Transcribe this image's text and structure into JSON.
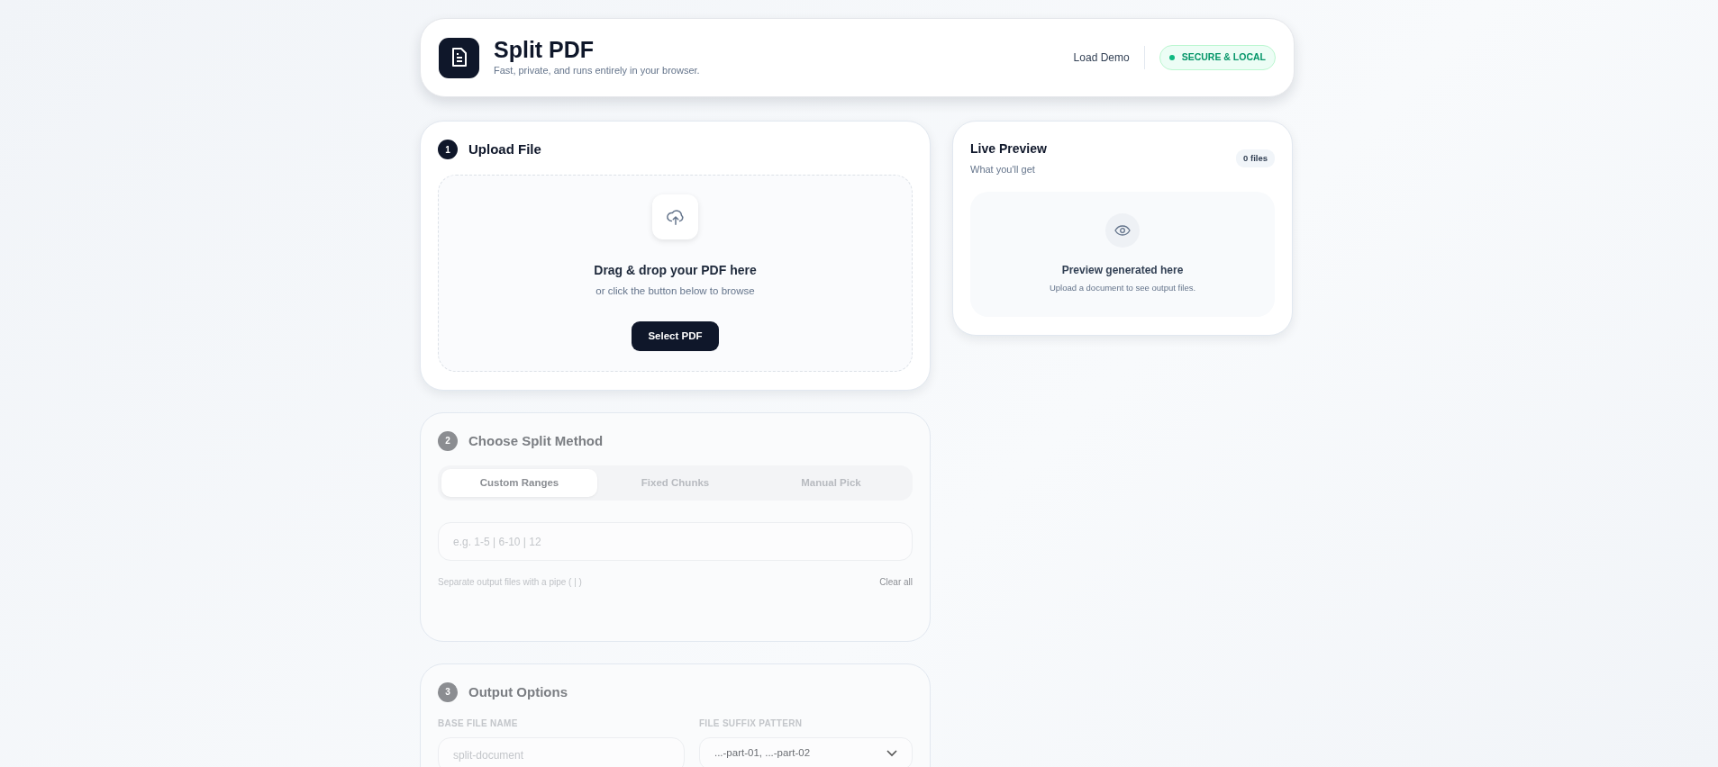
{
  "header": {
    "title": "Split PDF",
    "subtitle": "Fast, private, and runs entirely in your browser.",
    "link": "Load Demo",
    "badge": "SECURE & LOCAL"
  },
  "upload": {
    "step": "1",
    "title": "Upload File",
    "disabled": false,
    "drop_title": "Drag & drop your PDF here",
    "drop_hint": "or click the button below to browse",
    "button": "Select PDF"
  },
  "split_method": {
    "step": "2",
    "title": "Choose Split Method",
    "disabled": true,
    "tabs": [
      {
        "label": "Custom Ranges",
        "selected": true
      },
      {
        "label": "Fixed Chunks",
        "selected": false
      },
      {
        "label": "Manual Pick",
        "selected": false
      }
    ],
    "ranges": {
      "placeholder": "e.g. 1-5 | 6-10 | 12"
    },
    "hint": "Separate output files with a pipe ( | )",
    "clear": "Clear all"
  },
  "output_options": {
    "step": "3",
    "title": "Output Options",
    "disabled": true,
    "base_name": {
      "label": "BASE FILE NAME",
      "placeholder": "split-document"
    },
    "suffix": {
      "label": "FILE SUFFIX PATTERN",
      "value": "...-part-01, ...-part-02"
    }
  },
  "preview": {
    "title": "Live Preview",
    "subtitle": "What you'll get",
    "count": "0 files",
    "empty_title": "Preview generated here",
    "empty_hint": "Upload a document to see output files."
  }
}
